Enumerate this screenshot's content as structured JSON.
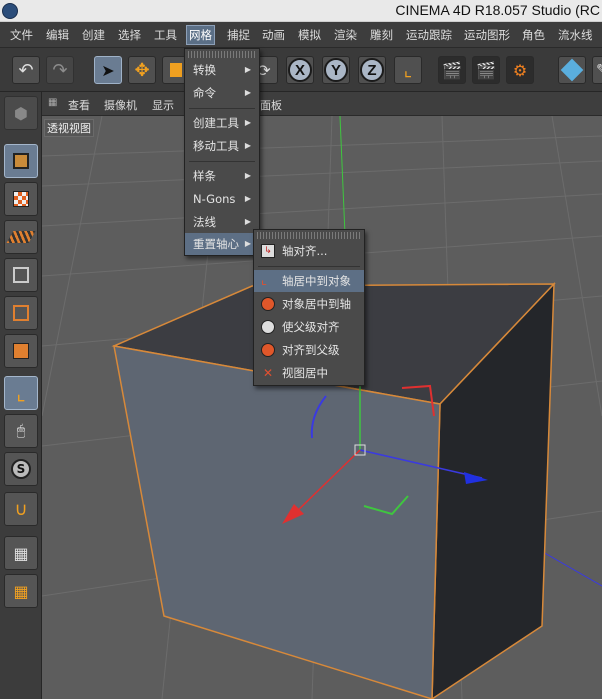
{
  "window": {
    "title": "CINEMA 4D R18.057 Studio (RC"
  },
  "menubar": {
    "items": [
      "文件",
      "编辑",
      "创建",
      "选择",
      "工具",
      "网格",
      "捕捉",
      "动画",
      "模拟",
      "渲染",
      "雕刻",
      "运动跟踪",
      "运动图形",
      "角色",
      "流水线"
    ],
    "active": "网格"
  },
  "viewport": {
    "tabs": [
      "查看",
      "摄像机",
      "显示"
    ],
    "panel_tab": "面板",
    "label": "透视视图"
  },
  "toolbar": {
    "axis_x": "X",
    "axis_y": "Y",
    "axis_z": "Z"
  },
  "mesh_menu": {
    "items": [
      {
        "label": "转换"
      },
      {
        "label": "命令"
      },
      {
        "label": "创建工具"
      },
      {
        "label": "移动工具"
      },
      {
        "label": "样条"
      },
      {
        "label": "N-Gons"
      },
      {
        "label": "法线"
      },
      {
        "label": "重置轴心"
      }
    ],
    "highlighted": "重置轴心"
  },
  "axis_submenu": {
    "items": [
      {
        "label": "轴对齐..."
      },
      {
        "label": "轴居中到对象"
      },
      {
        "label": "对象居中到轴"
      },
      {
        "label": "使父级对齐"
      },
      {
        "label": "对齐到父级"
      },
      {
        "label": "视图居中"
      }
    ],
    "highlighted": "轴居中到对象"
  },
  "colors": {
    "accent": "#5d6f85",
    "cube_edge": "#d7893a",
    "axis_x": "#e03030",
    "axis_y": "#30c030",
    "axis_z": "#3040e0"
  }
}
